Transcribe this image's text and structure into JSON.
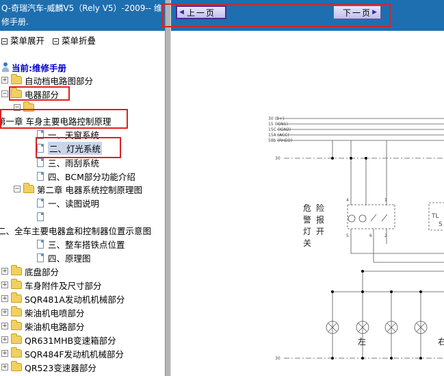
{
  "app": {
    "title": "Q-奇瑞汽车-威麟V5（Rely V5）-2009-- 维修手册."
  },
  "menu_ops": {
    "expand": "菜单展开",
    "collapse": "菜单折叠"
  },
  "tree": {
    "current_prefix": "当前:",
    "current": "维修手册",
    "items": [
      {
        "label": "自动档电路图部分"
      },
      {
        "label": "电器部分"
      },
      {
        "label": ""
      },
      {
        "label": "第一章 车身主要电路控制原理"
      },
      {
        "label": "一、天窗系统"
      },
      {
        "label": "二、灯光系统"
      },
      {
        "label": "三、雨刮系统"
      },
      {
        "label": "四、BCM部分功能介绍"
      },
      {
        "label": "第二章 电器系统控制原理图"
      },
      {
        "label": "一、读图说明"
      },
      {
        "label": ""
      },
      {
        "label": "二、全车主要电器盒和控制器位置示意图"
      },
      {
        "label": "三、整车搭铁点位置"
      },
      {
        "label": "四、原理图"
      },
      {
        "label": "底盘部分"
      },
      {
        "label": "车身附件及尺寸部分"
      },
      {
        "label": "SQR481A发动机机械部分"
      },
      {
        "label": "柴油机电喷部分"
      },
      {
        "label": "柴油机电路部分"
      },
      {
        "label": "QR631MHB变速箱部分"
      },
      {
        "label": "SQR484F发动机机械部分"
      },
      {
        "label": "QR523变速器部分"
      }
    ]
  },
  "nav": {
    "prev": "上一页",
    "next": "下一页"
  },
  "diagram": {
    "power_lines": [
      "30 (B+)",
      "15 (IGN1)",
      "15C (IGN2)",
      "15A (ACC)",
      "58b (RHEO)"
    ],
    "line_30_label": "30",
    "switch_label": [
      "危",
      "险",
      "警",
      "报",
      "灯",
      "开",
      "关"
    ],
    "pin_4": "4",
    "pin_1": "1",
    "pin_5": "5",
    "pin_6": "6",
    "pin_2": "2",
    "side_left": "左",
    "side_right": "右",
    "module_label": "TL",
    "module_label_2": "S"
  },
  "colors": {
    "title_bar": "#1d6fb0",
    "highlight": "#e02020",
    "current_text": "#0000cc"
  }
}
